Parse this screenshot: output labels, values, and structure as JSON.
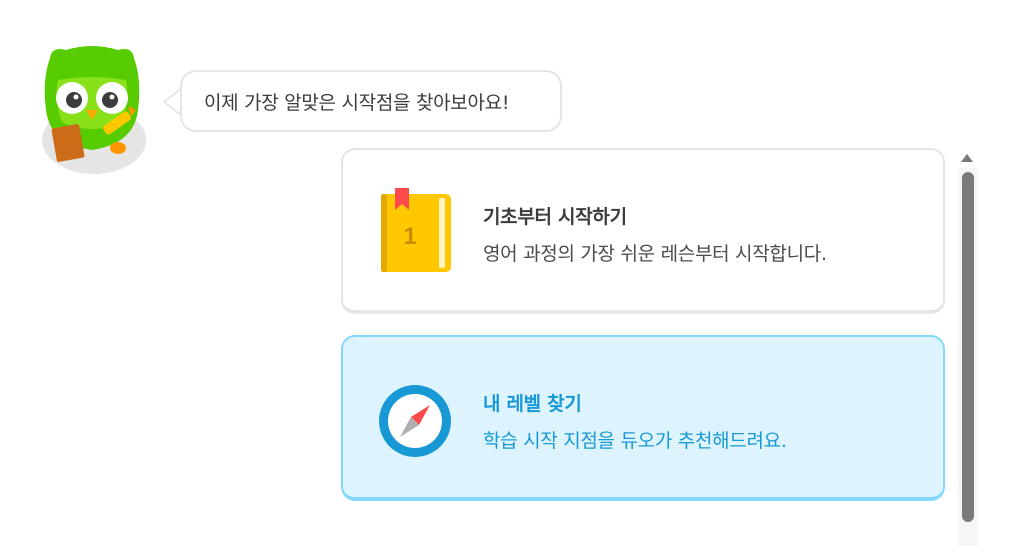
{
  "mascot": {
    "icon": "duo-owl-icon"
  },
  "speech_bubble": {
    "text": "이제 가장 알맞은 시작점을 찾아보아요!"
  },
  "options": [
    {
      "title": "기초부터 시작하기",
      "description": "영어 과정의 가장 쉬운 레슨부터 시작합니다.",
      "icon": "book-icon",
      "book_number": "1",
      "selected": false
    },
    {
      "title": "내 레벨 찾기",
      "description": "학습 시작 지점을 듀오가 추천해드려요.",
      "icon": "compass-icon",
      "selected": true
    }
  ],
  "colors": {
    "selected_bg": "#ddf4ff",
    "selected_border": "#84d8ff",
    "selected_text": "#1899d6",
    "owl_green": "#58cc02",
    "book_yellow": "#ffc800"
  }
}
